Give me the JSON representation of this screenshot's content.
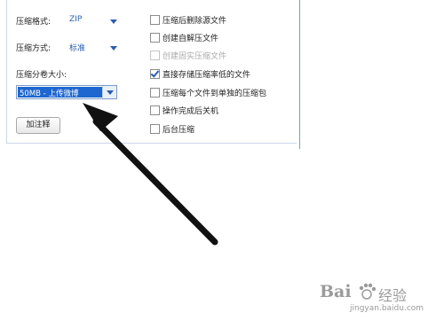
{
  "compress": {
    "format_label": "压缩格式:",
    "format_value": "ZIP",
    "method_label": "压缩方式:",
    "method_value": "标准",
    "volume_label": "压缩分卷大小:",
    "volume_value": "50MB  - 上传微博",
    "note_button": "加注释"
  },
  "options": [
    {
      "label": "压缩后删除源文件",
      "checked": false,
      "disabled": false
    },
    {
      "label": "创建自解压文件",
      "checked": false,
      "disabled": false
    },
    {
      "label": "创建固实压缩文件",
      "checked": false,
      "disabled": true
    },
    {
      "label": "直接存储压缩率低的文件",
      "checked": true,
      "disabled": false
    },
    {
      "label": "压缩每个文件到单独的压缩包",
      "checked": false,
      "disabled": false
    },
    {
      "label": "操作完成后关机",
      "checked": false,
      "disabled": false
    },
    {
      "label": "后台压缩",
      "checked": false,
      "disabled": false
    }
  ],
  "watermark": {
    "brand": "Bai",
    "brand_cn": "经验",
    "url": "jingyan.baidu.com"
  },
  "colors": {
    "accent": "#2a5db0",
    "selection": "#1e66d0",
    "arrow": "#111111"
  }
}
